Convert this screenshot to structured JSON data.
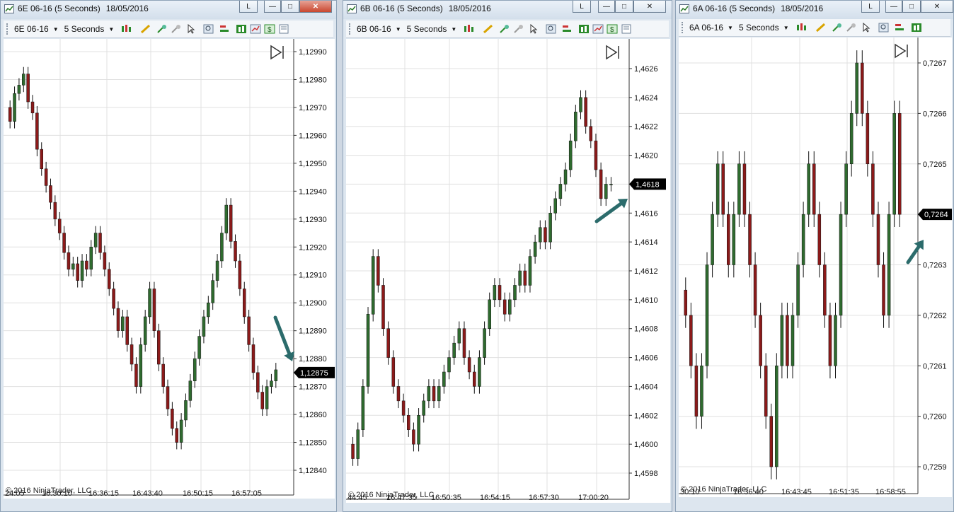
{
  "windows": [
    {
      "id": "w1",
      "title": "6E 06-16 (5 Seconds)",
      "date": "18/05/2016",
      "toolbar_instrument": "6E 06-16",
      "toolbar_interval": "5 Seconds",
      "copyright": "© 2016 NinjaTrader, LLC",
      "price_labels": [
        "1,12990",
        "1,12980",
        "1,12970",
        "1,12960",
        "1,12950",
        "1,12940",
        "1,12930",
        "1,12920",
        "1,12910",
        "1,12900",
        "1,12890",
        "1,12880",
        "1,12870",
        "1,12860",
        "1,12850",
        "1,12840"
      ],
      "time_labels": [
        "24:05",
        "16:30:10",
        "16:36:15",
        "16:43:40",
        "16:50:15",
        "16:57:05"
      ],
      "current_price": "1,12875",
      "chart_data": {
        "type": "bar",
        "instrument": "6E 06-16",
        "interval": "5 Seconds",
        "y_range": [
          1.1284,
          1.1299
        ],
        "current_price": 1.12875,
        "closes": [
          1.12965,
          1.12975,
          1.12978,
          1.12982,
          1.12972,
          1.12968,
          1.12955,
          1.12948,
          1.12942,
          1.12936,
          1.1293,
          1.12925,
          1.12918,
          1.12912,
          1.12914,
          1.12908,
          1.12915,
          1.12912,
          1.1292,
          1.12925,
          1.12918,
          1.12912,
          1.12905,
          1.12898,
          1.1289,
          1.12895,
          1.12885,
          1.12878,
          1.1287,
          1.12885,
          1.12895,
          1.12905,
          1.1289,
          1.12878,
          1.1287,
          1.12862,
          1.12855,
          1.1285,
          1.12858,
          1.12865,
          1.12872,
          1.1288,
          1.12888,
          1.12895,
          1.129,
          1.12908,
          1.12915,
          1.12925,
          1.12935,
          1.12922,
          1.12915,
          1.12905,
          1.12895,
          1.12885,
          1.12875,
          1.12868,
          1.12862,
          1.1287,
          1.12872,
          1.12876
        ]
      }
    },
    {
      "id": "w2",
      "title": "6B 06-16 (5 Seconds)",
      "date": "18/05/2016",
      "toolbar_instrument": "6B 06-16",
      "toolbar_interval": "5 Seconds",
      "copyright": "© 2016 NinjaTrader, LLC",
      "price_labels": [
        "1,4626",
        "1,4624",
        "1,4622",
        "1,4620",
        "1,4618",
        "1,4616",
        "1,4614",
        "1,4612",
        "1,4610",
        "1,4608",
        "1,4606",
        "1,4604",
        "1,4602",
        "1,4600",
        "1,4598"
      ],
      "time_labels": [
        "44:45",
        "16:47:35",
        "16:50:35",
        "16:54:15",
        "16:57:30",
        "17:00:20"
      ],
      "current_price": "1,4618",
      "chart_data": {
        "type": "bar",
        "instrument": "6B 06-16",
        "interval": "5 Seconds",
        "y_range": [
          1.4597,
          1.4627
        ],
        "current_price": 1.4618,
        "closes": [
          1.4599,
          1.4601,
          1.4604,
          1.4609,
          1.4613,
          1.4611,
          1.4608,
          1.4606,
          1.4604,
          1.4603,
          1.4602,
          1.4601,
          1.46,
          1.4602,
          1.4603,
          1.4604,
          1.4603,
          1.4604,
          1.4605,
          1.4606,
          1.4607,
          1.4608,
          1.4606,
          1.4605,
          1.4604,
          1.4606,
          1.4608,
          1.461,
          1.4611,
          1.461,
          1.4609,
          1.461,
          1.4611,
          1.4612,
          1.4611,
          1.4613,
          1.4614,
          1.4615,
          1.4614,
          1.4616,
          1.4617,
          1.4618,
          1.4619,
          1.4621,
          1.4623,
          1.4624,
          1.4622,
          1.4621,
          1.4619,
          1.4617,
          1.4618,
          1.4618
        ]
      }
    },
    {
      "id": "w3",
      "title": "6A 06-16 (5 Seconds)",
      "date": "18/05/2016",
      "toolbar_instrument": "6A 06-16",
      "toolbar_interval": "5 Seconds",
      "copyright": "© 2016 NinjaTrader, LLC",
      "price_labels": [
        "0,7267",
        "0,7266",
        "0,7265",
        "0,7264",
        "0,7263",
        "0,7262",
        "0,7261",
        "0,7260",
        "0,7259"
      ],
      "time_labels": [
        "30:10",
        "16:36:40",
        "16:43:45",
        "16:51:35",
        "16:58:55"
      ],
      "current_price": "0,7264",
      "chart_data": {
        "type": "bar",
        "instrument": "6A 06-16",
        "interval": "5 Seconds",
        "y_range": [
          1.4597,
          0.72672
        ],
        "current_price": 0.7264,
        "closes": [
          0.7262,
          0.7261,
          0.726,
          0.7261,
          0.7263,
          0.7264,
          0.7265,
          0.7264,
          0.7263,
          0.7264,
          0.7265,
          0.7264,
          0.7263,
          0.7262,
          0.7261,
          0.726,
          0.7259,
          0.7261,
          0.7262,
          0.7261,
          0.7262,
          0.7263,
          0.7264,
          0.7265,
          0.7264,
          0.7263,
          0.7262,
          0.7261,
          0.7262,
          0.7264,
          0.7265,
          0.7266,
          0.7267,
          0.7266,
          0.7265,
          0.7264,
          0.7263,
          0.7262,
          0.7264,
          0.7266,
          0.7264
        ]
      }
    }
  ],
  "colors": {
    "up_bar": "#2f6b2f",
    "down_bar": "#8b1a1a",
    "arrow": "#2b6b6b",
    "grid": "#e0e0e0"
  }
}
